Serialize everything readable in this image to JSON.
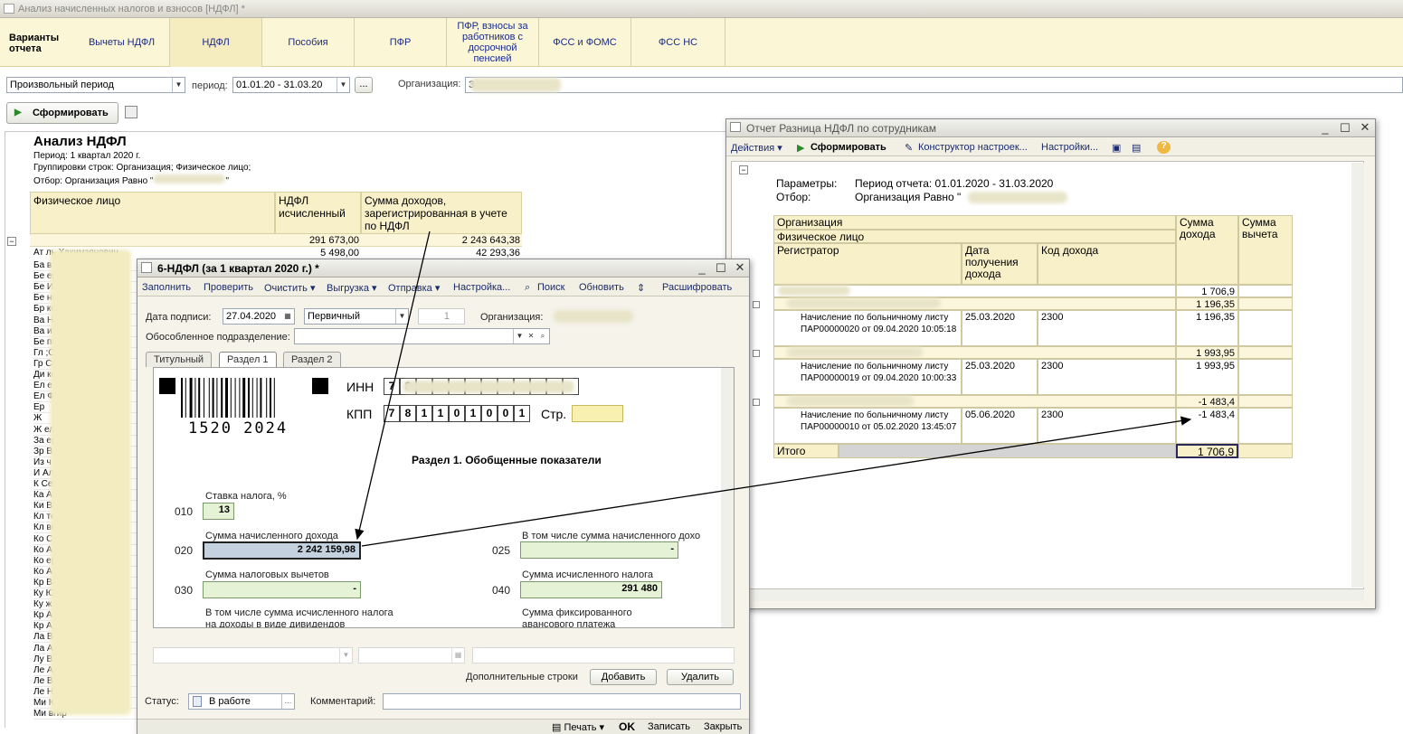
{
  "main": {
    "title": "Анализ начисленных налогов и взносов [НДФЛ] *",
    "variants_label": "Варианты отчета",
    "tabs": [
      "Вычеты НДФЛ",
      "НДФЛ",
      "Пособия",
      "ПФР",
      "ПФР, взносы за работников с досрочной пенсией",
      "ФСС и ФОМС",
      "ФСС НС"
    ],
    "period_type": "Произвольный период",
    "period_label": "период:",
    "period_value": "01.01.20 - 31.03.20",
    "dots": "...",
    "org_label": "Организация:",
    "org_value": "ЗА",
    "form_button": "Сформировать"
  },
  "report": {
    "title": "Анализ НДФЛ",
    "period": "Период: 1 квартал 2020 г.",
    "grouping": "Группировки строк: Организация; Физическое лицо;",
    "filter": "Отбор: Организация Равно \"",
    "filter_end": "\"",
    "col_person": "Физическое лицо",
    "col_ndfl": "НДФЛ исчисленный",
    "col_income": "Сумма доходов, зарегистрированная в учете по НДФЛ",
    "total_ndfl": "291 673,00",
    "total_income": "2 243 643,38",
    "row1_name": "Ат                   ль Хакимзянович",
    "row1_ndfl": "5 498,00",
    "row1_income": "42 293,36",
    "left_names": [
      "Ба        в       Сер",
      "Бе        ер     ий В",
      "Бе      Ир        ге",
      "Бе       но     Хв",
      "Бр     ко     Иря",
      "Ва     Ни      ЙИ",
      "Ва      ит         ",
      "Бе     по      Па",
      "Гл    ;Сте   Ми",
      "Гр        Сергей В",
      "Ди              ко",
      "Ел         е       ",
      "Ел       Фрей     ",
      "Ер                  ",
      "Ж                   ",
      "Ж               ел  ",
      "За            ерв   ",
      "Зр              В   ",
      "Из              ч   ",
      "И           Алекса",
      "К      Сергей Ал",
      "Ка      Алексе А",
      "Ки          Витал",
      "Кл     те   Ви   ",
      "Кл       во    Ал",
      "Ко     Сергей Ал",
      "Ко         Алекс",
      "Ко         ерт   ",
      "Ко          Ака",
      "Кр          Ваю",
      "Ку       Ю     Ан",
      "Ку       ж   Ис",
      "Кр       Алек  ",
      "Кр           Алс",
      "Ла       Ви    ",
      "Ла              Ал",
      "Лу         Вл    ",
      "Ле          Ал   ",
      "Ле        Вик  ",
      "Ле        Никол  ",
      "Ми         Юрий  ",
      "Ми          вгир  "
    ]
  },
  "ndfl6": {
    "title": "6-НДФЛ (за 1 квартал 2020 г.) *",
    "toolbar": [
      "Заполнить",
      "Проверить",
      "Очистить",
      "Выгрузка",
      "Отправка",
      "Настройка...",
      "Поиск",
      "Обновить",
      "Расшифровать"
    ],
    "sign_date_label": "Дата подписи:",
    "sign_date": "27.04.2020",
    "doc_type": "Первичный",
    "corr_num": "1",
    "org_label": "Организация:",
    "subdiv_label": "Обособленное подразделение:",
    "tabs": [
      "Титульный",
      "Раздел 1",
      "Раздел 2"
    ],
    "barcode_num": "1520 2024",
    "inn_label": "ИНН",
    "inn_digits": [
      "7",
      "8",
      "",
      "",
      "",
      "",
      "",
      "",
      "",
      "",
      "",
      ""
    ],
    "kpp_label": "КПП",
    "kpp_digits": [
      "7",
      "8",
      "1",
      "1",
      "0",
      "1",
      "0",
      "0",
      "1"
    ],
    "page_label": "Стр.",
    "section_title": "Раздел 1. Обобщенные показатели",
    "l010": "Ставка налога, %",
    "c010": "010",
    "v010": "13",
    "l020": "Сумма начисленного дохода",
    "c020": "020",
    "v020": "2 242 159,98",
    "l025": "В том числе сумма начисленного дохо",
    "c025": "025",
    "v025": "-",
    "l030": "Сумма налоговых вычетов",
    "c030": "030",
    "v030": "-",
    "l040": "Сумма исчисленного налога",
    "c040": "040",
    "v040": "291 480",
    "l_div": "В том числе сумма исчисленного налога на доходы в виде дивидендов",
    "l_fixed": "Сумма фиксированного авансового платежа",
    "extra_lines": "Дополнительные строки",
    "add_button": "Добавить",
    "delete_button": "Удалить",
    "status_label": "Статус:",
    "status_value": "В работе",
    "comment_label": "Комментарий:",
    "print": "Печать",
    "ok": "OK",
    "save": "Записать",
    "close": "Закрыть"
  },
  "diff": {
    "title": "Отчет  Разница НДФЛ по сотрудникам",
    "actions": "Действия",
    "form": "Сформировать",
    "constructor": "Конструктор настроек...",
    "settings": "Настройки...",
    "params_label": "Параметры:",
    "params_value": "Период отчета: 01.01.2020 - 31.03.2020",
    "filter_label": "Отбор:",
    "filter_value": "Организация Равно \"",
    "h_org": "Организация",
    "h_person": "Физическое лицо",
    "h_reg": "Регистратор",
    "h_date": "Дата получения дохода",
    "h_code": "Код дохода",
    "h_income": "Сумма дохода",
    "h_deduct": "Сумма вычета",
    "org_total": "1 706,9",
    "p1_name": "Б          Игор   Александрович",
    "p1_sum": "1 196,35",
    "r1_doc": "Начисление по больничному листу ПАР00000020 от 09.04.2020 10:05:18",
    "r1_date": "25.03.2020",
    "r1_code": "2300",
    "r1_sum": "1 196,35",
    "p2_name": "К          Руслан Р         ч",
    "p2_sum": "1 993,95",
    "r2_doc": "Начисление по больничному листу ПАР00000019 от 09.04.2020 10:00:33",
    "r2_date": "25.03.2020",
    "r2_code": "2300",
    "r2_sum": "1 993,95",
    "p3_name": "                      ерович",
    "p3_sum": "-1 483,4",
    "r3_doc": "Начисление по больничному листу ПАР00000010 от 05.02.2020 13:45:07",
    "r3_date": "05.06.2020",
    "r3_code": "2300",
    "r3_sum": "-1 483,4",
    "total_label": "Итого",
    "total_sum": "1 706,9"
  }
}
